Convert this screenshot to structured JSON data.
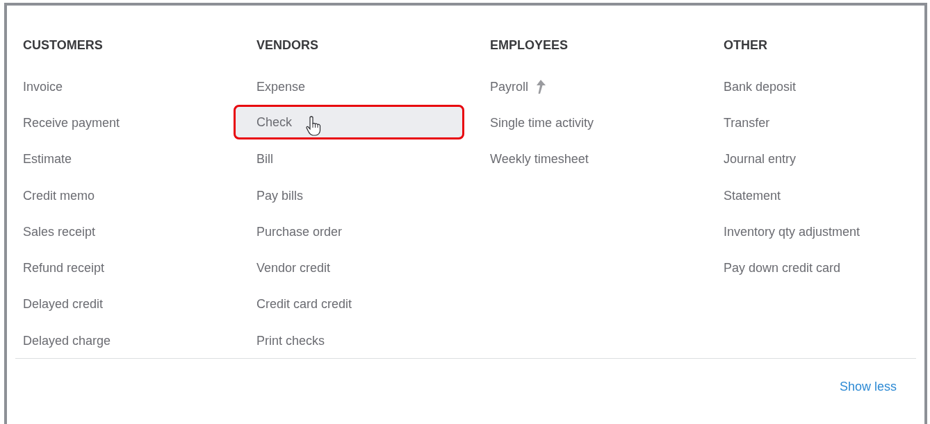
{
  "columns": [
    {
      "heading": "CUSTOMERS",
      "items": [
        {
          "label": "Invoice",
          "kind": "plain",
          "selected": false
        },
        {
          "label": "Receive payment",
          "kind": "plain",
          "selected": false
        },
        {
          "label": "Estimate",
          "kind": "plain",
          "selected": false
        },
        {
          "label": "Credit memo",
          "kind": "plain",
          "selected": false
        },
        {
          "label": "Sales receipt",
          "kind": "plain",
          "selected": false
        },
        {
          "label": "Refund receipt",
          "kind": "plain",
          "selected": false
        },
        {
          "label": "Delayed credit",
          "kind": "plain",
          "selected": false
        },
        {
          "label": "Delayed charge",
          "kind": "plain",
          "selected": false
        }
      ]
    },
    {
      "heading": "VENDORS",
      "items": [
        {
          "label": "Expense",
          "kind": "plain",
          "selected": false
        },
        {
          "label": "Check",
          "kind": "plain",
          "selected": true
        },
        {
          "label": "Bill",
          "kind": "plain",
          "selected": false
        },
        {
          "label": "Pay bills",
          "kind": "plain",
          "selected": false
        },
        {
          "label": "Purchase order",
          "kind": "plain",
          "selected": false
        },
        {
          "label": "Vendor credit",
          "kind": "plain",
          "selected": false
        },
        {
          "label": "Credit card credit",
          "kind": "plain",
          "selected": false
        },
        {
          "label": "Print checks",
          "kind": "plain",
          "selected": false
        }
      ]
    },
    {
      "heading": "EMPLOYEES",
      "items": [
        {
          "label": "Payroll",
          "kind": "upgrade",
          "selected": false
        },
        {
          "label": "Single time activity",
          "kind": "plain",
          "selected": false
        },
        {
          "label": "Weekly timesheet",
          "kind": "plain",
          "selected": false
        }
      ]
    },
    {
      "heading": "OTHER",
      "items": [
        {
          "label": "Bank deposit",
          "kind": "plain",
          "selected": false
        },
        {
          "label": "Transfer",
          "kind": "plain",
          "selected": false
        },
        {
          "label": "Journal entry",
          "kind": "plain",
          "selected": false
        },
        {
          "label": "Statement",
          "kind": "plain",
          "selected": false
        },
        {
          "label": "Inventory qty adjustment",
          "kind": "plain",
          "selected": false
        },
        {
          "label": "Pay down credit card",
          "kind": "plain",
          "selected": false
        }
      ]
    }
  ],
  "footer_link": "Show less"
}
